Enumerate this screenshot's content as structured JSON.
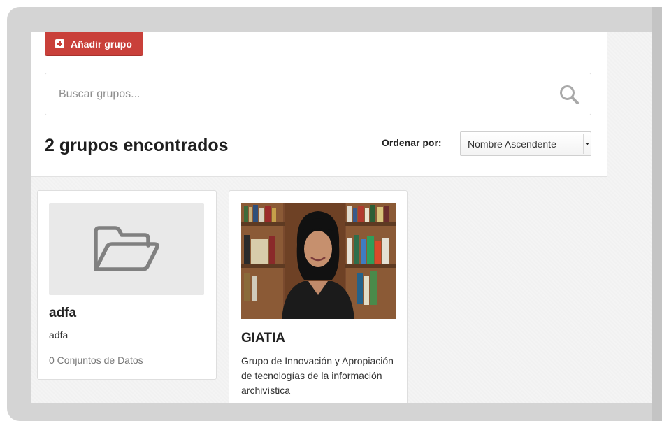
{
  "toolbar": {
    "add_group_label": "Añadir grupo"
  },
  "search": {
    "placeholder": "Buscar grupos...",
    "value": ""
  },
  "results": {
    "title": "2 grupos encontrados",
    "sort_label": "Ordenar por:",
    "sort_selected": "Nombre Ascendente"
  },
  "groups": [
    {
      "name": "adfa",
      "description": "adfa",
      "count": "0 Conjuntos de Datos",
      "image": "folder-open-icon"
    },
    {
      "name": "GIATIA",
      "description": "Grupo de Innovación y Apropiación de tecnologías de la información archivística",
      "image": "group-photo"
    }
  ],
  "colors": {
    "primary_button": "#c9403a",
    "frame": "#d4d4d4"
  }
}
